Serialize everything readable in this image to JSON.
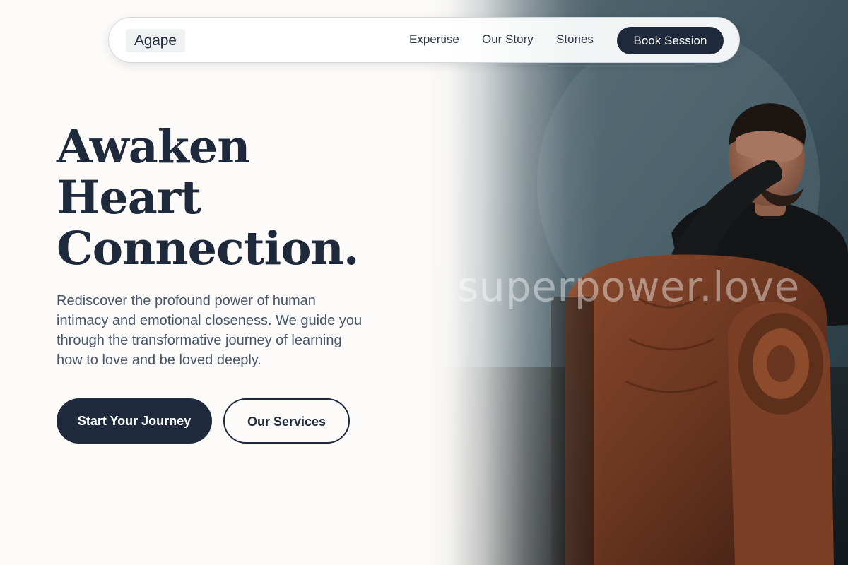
{
  "nav": {
    "logo": "Agape",
    "links": [
      "Expertise",
      "Our Story",
      "Stories"
    ],
    "cta": "Book Session"
  },
  "hero": {
    "headline": [
      "Awaken",
      "Heart",
      "Connection."
    ],
    "description": "Rediscover the profound power of human intimacy and emotional closeness. We guide you through the transformative journey of learning how to love and be loved deeply.",
    "primary_button": "Start Your Journey",
    "secondary_button": "Our Services",
    "watermark": "superpower.love"
  },
  "colors": {
    "brand_dark": "#1e293b",
    "background": "#fcfbf9",
    "body_text": "#475569"
  }
}
